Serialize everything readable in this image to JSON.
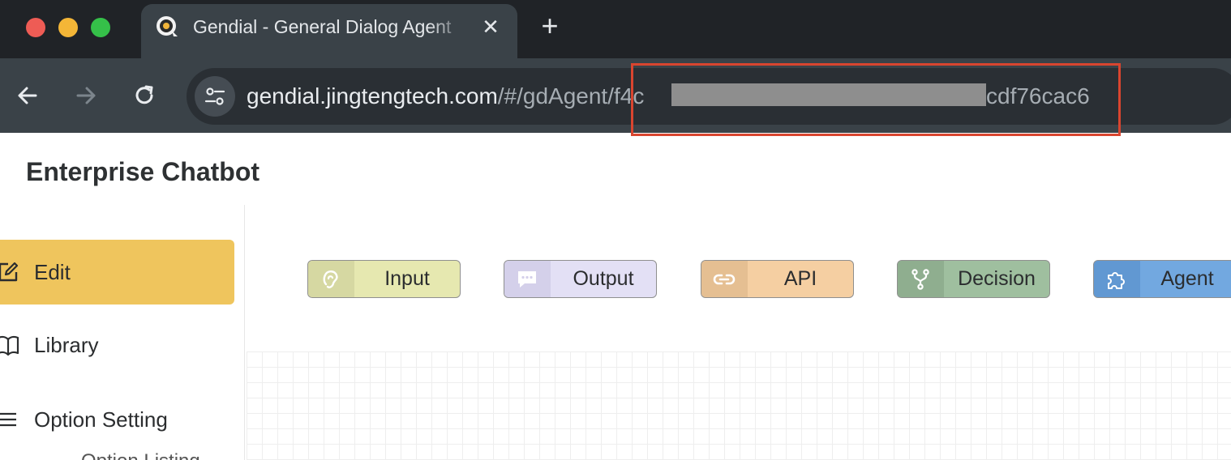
{
  "browser": {
    "tab": {
      "title": "Gendial - General Dialog Agent",
      "favicon": "gendial-logo-icon",
      "close_icon": "close-icon"
    },
    "new_tab_icon": "plus-icon",
    "nav": {
      "back_icon": "arrow-left-icon",
      "forward_icon": "arrow-right-icon",
      "reload_icon": "reload-icon",
      "site_info_icon": "tune-icon"
    },
    "address": {
      "host": "gendial.jingtengtech.com",
      "path": "/#/gdAgent/f4c",
      "tail": "cdf76cac6"
    },
    "colors": {
      "highlight": "#d9452f",
      "tab_bg": "#3a4248",
      "strip_bg": "#202327"
    }
  },
  "app": {
    "title": "Enterprise Chatbot",
    "sidebar": {
      "items": [
        {
          "label": "Edit",
          "icon": "edit-icon",
          "active": true
        },
        {
          "label": "Library",
          "icon": "book-icon",
          "active": false
        },
        {
          "label": "Option Setting",
          "icon": "menu-icon",
          "active": false
        }
      ],
      "sub_item": "Option Listing",
      "active_color": "#efc55d"
    },
    "nodes": [
      {
        "label": "Input",
        "icon": "ear-icon",
        "color": "#e6e8b0",
        "icon_bg": "#d6d8a2"
      },
      {
        "label": "Output",
        "icon": "chat-bubble-icon",
        "color": "#e3e0f5",
        "icon_bg": "#d4d0ea"
      },
      {
        "label": "API",
        "icon": "link-icon",
        "color": "#f5cfa2",
        "icon_bg": "#e5bf92"
      },
      {
        "label": "Decision",
        "icon": "branch-icon",
        "color": "#9fbf9f",
        "icon_bg": "#8fae8f"
      },
      {
        "label": "Agent",
        "icon": "puzzle-icon",
        "color": "#72a8e0",
        "icon_bg": "#6198d2"
      }
    ]
  }
}
